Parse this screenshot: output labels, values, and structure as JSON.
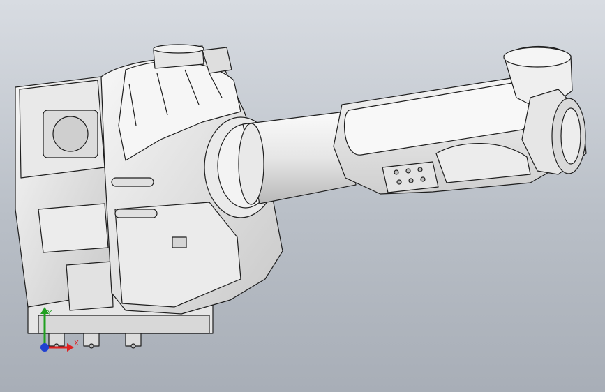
{
  "triad": {
    "x_label": "X",
    "y_label": "Y",
    "x_color": "#e02020",
    "y_color": "#20a020",
    "z_color": "#2040d0"
  },
  "colors": {
    "background_top": "#d8dce2",
    "background_bottom": "#a8aeb7",
    "part_fill": "#f1f1f1",
    "part_shade": "#d0d0d0",
    "edge": "#1e1e1e"
  }
}
